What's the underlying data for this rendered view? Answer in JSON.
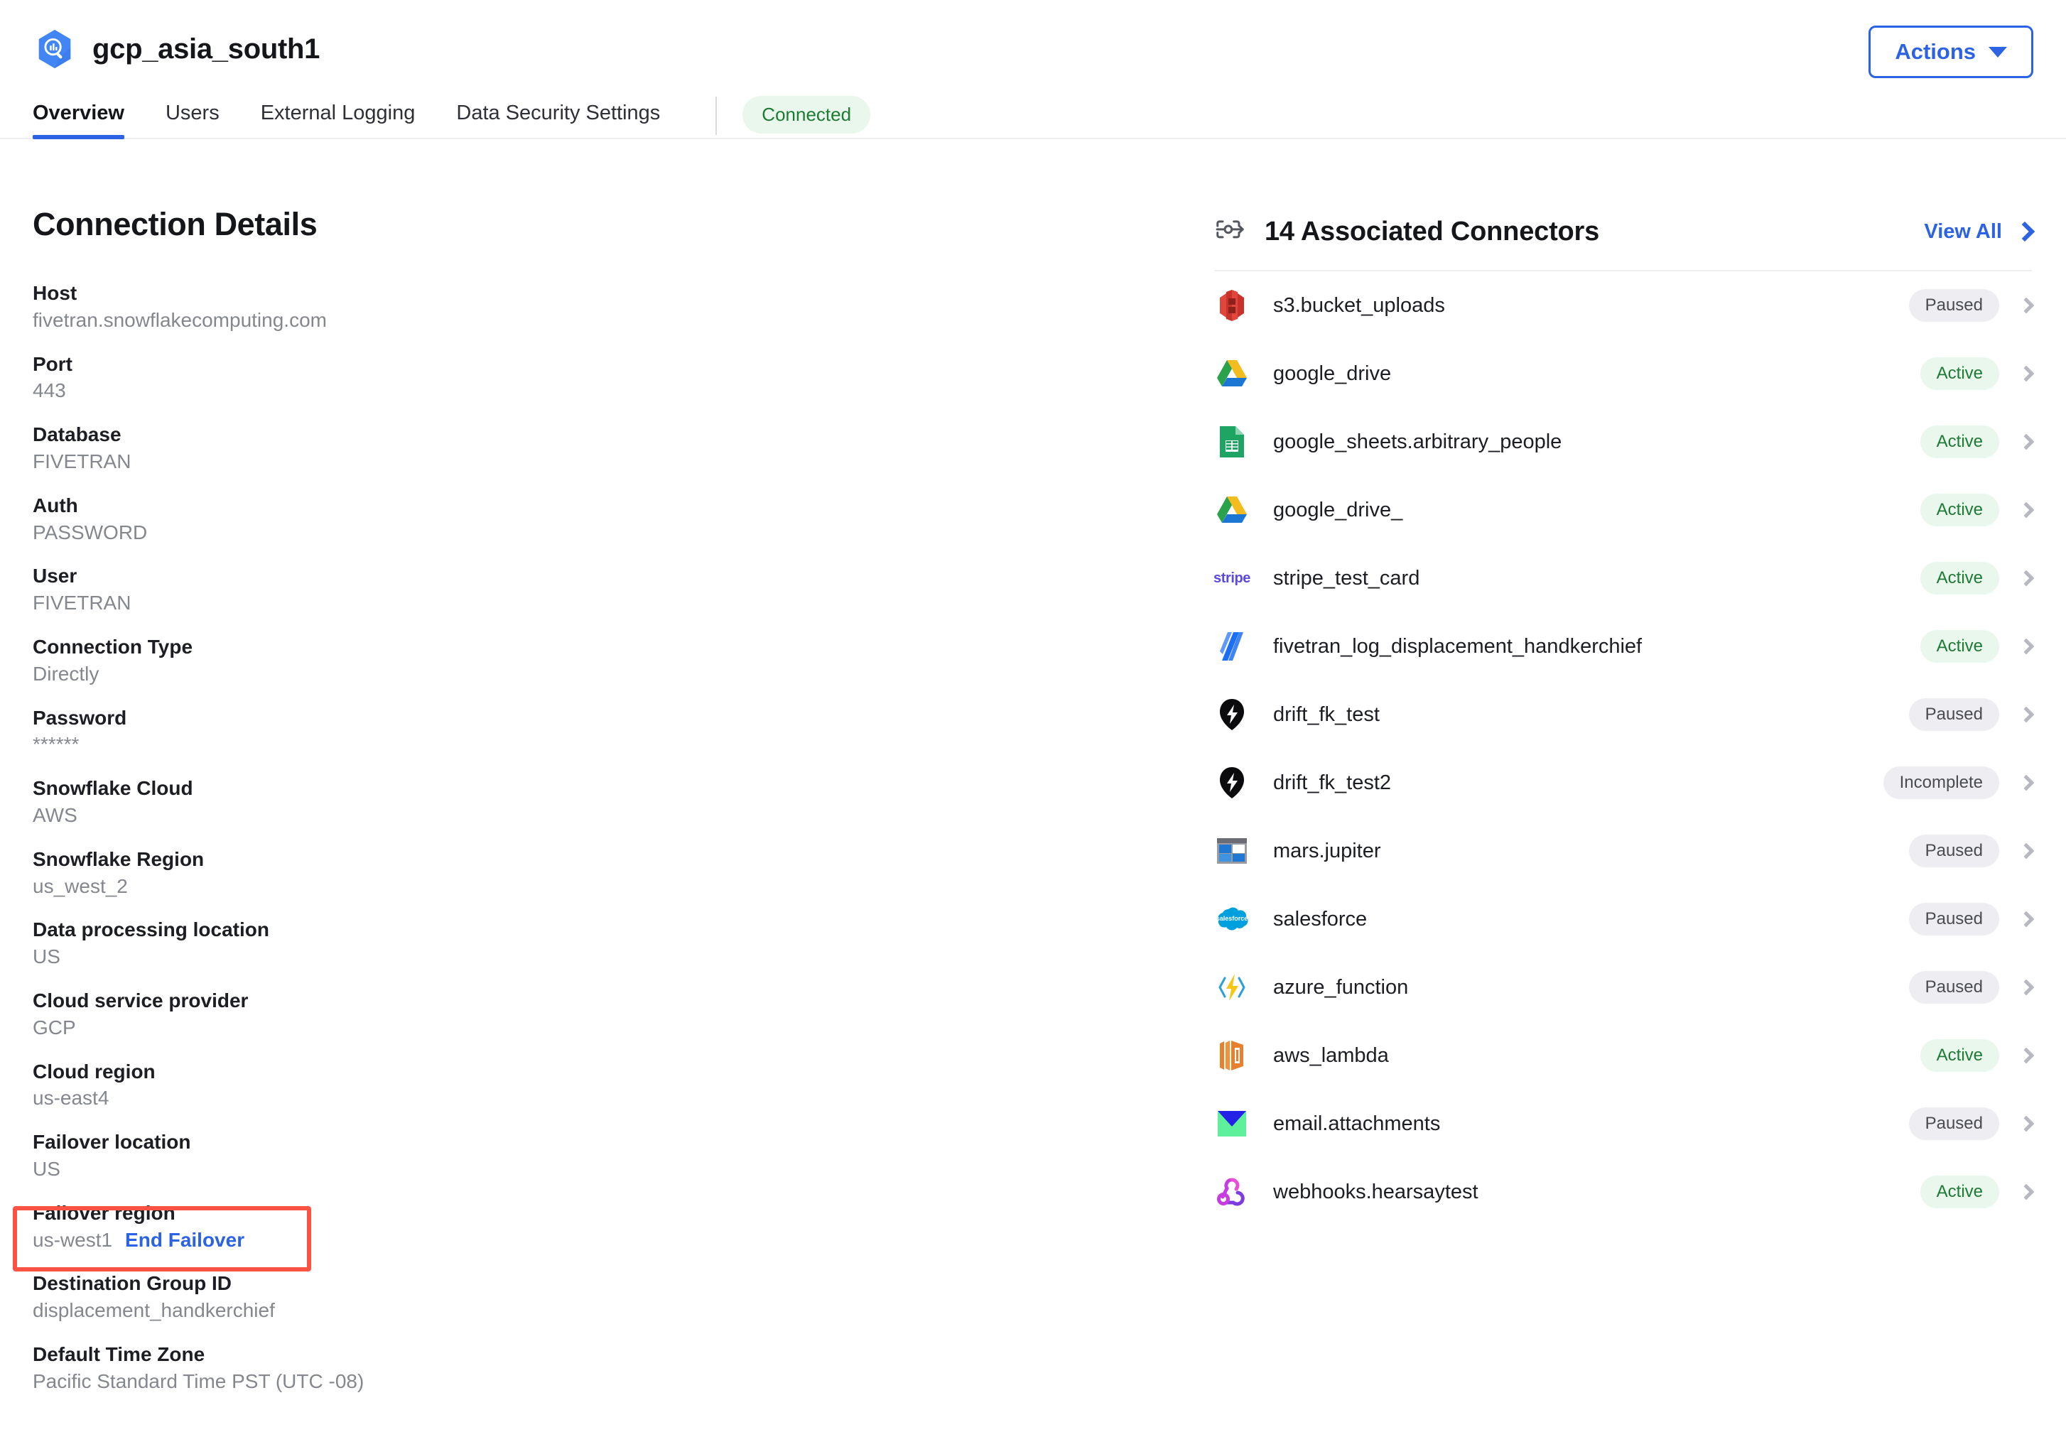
{
  "header": {
    "app_icon": "bigquery-hexagon-icon",
    "title": "gcp_asia_south1",
    "tabs": [
      {
        "label": "Overview",
        "active": true
      },
      {
        "label": "Users",
        "active": false
      },
      {
        "label": "External Logging",
        "active": false
      },
      {
        "label": "Data Security Settings",
        "active": false
      }
    ],
    "connection_status": "Connected",
    "actions_button": "Actions"
  },
  "details": {
    "title": "Connection Details",
    "fields": [
      {
        "label": "Host",
        "value": "fivetran.snowflakecomputing.com"
      },
      {
        "label": "Port",
        "value": "443"
      },
      {
        "label": "Database",
        "value": "FIVETRAN"
      },
      {
        "label": "Auth",
        "value": "PASSWORD"
      },
      {
        "label": "User",
        "value": "FIVETRAN"
      },
      {
        "label": "Connection Type",
        "value": "Directly"
      },
      {
        "label": "Password",
        "value": "******"
      },
      {
        "label": "Snowflake Cloud",
        "value": "AWS"
      },
      {
        "label": "Snowflake Region",
        "value": "us_west_2"
      },
      {
        "label": "Data processing location",
        "value": "US"
      },
      {
        "label": "Cloud service provider",
        "value": "GCP"
      },
      {
        "label": "Cloud region",
        "value": "us-east4"
      },
      {
        "label": "Failover location",
        "value": "US"
      },
      {
        "label": "Failover region",
        "value": "us-west1",
        "link": "End Failover",
        "highlighted": true
      },
      {
        "label": "Destination Group ID",
        "value": "displacement_handkerchief"
      },
      {
        "label": "Default Time Zone",
        "value": "Pacific Standard Time PST (UTC -08)"
      }
    ]
  },
  "connectors": {
    "header_icon": "connector-node-icon",
    "title": "14 Associated Connectors",
    "view_all": "View All",
    "rows": [
      {
        "name": "s3.bucket_uploads",
        "status": "Paused",
        "icon": "amazon-s3-icon"
      },
      {
        "name": "google_drive",
        "status": "Active",
        "icon": "google-drive-icon"
      },
      {
        "name": "google_sheets.arbitrary_people",
        "status": "Active",
        "icon": "google-sheets-icon"
      },
      {
        "name": "google_drive_",
        "status": "Active",
        "icon": "google-drive-icon"
      },
      {
        "name": "stripe_test_card",
        "status": "Active",
        "icon": "stripe-icon"
      },
      {
        "name": "fivetran_log_displacement_handkerchief",
        "status": "Active",
        "icon": "fivetran-log-icon"
      },
      {
        "name": "drift_fk_test",
        "status": "Paused",
        "icon": "drift-icon"
      },
      {
        "name": "drift_fk_test2",
        "status": "Incomplete",
        "icon": "drift-icon"
      },
      {
        "name": "mars.jupiter",
        "status": "Paused",
        "icon": "window-panes-icon"
      },
      {
        "name": "salesforce",
        "status": "Paused",
        "icon": "salesforce-cloud-icon"
      },
      {
        "name": "azure_function",
        "status": "Paused",
        "icon": "azure-function-icon"
      },
      {
        "name": "aws_lambda",
        "status": "Active",
        "icon": "aws-lambda-icon"
      },
      {
        "name": "email.attachments",
        "status": "Paused",
        "icon": "email-envelope-icon"
      },
      {
        "name": "webhooks.hearsaytest",
        "status": "Active",
        "icon": "webhooks-icon"
      }
    ]
  },
  "colors": {
    "accent_blue": "#2c63e5",
    "status_active_bg": "#e9f7ec",
    "status_active_text": "#1f7a34",
    "status_paused_bg": "#eeeef2",
    "status_paused_text": "#4a4b52",
    "highlight_border": "#fb5343"
  }
}
